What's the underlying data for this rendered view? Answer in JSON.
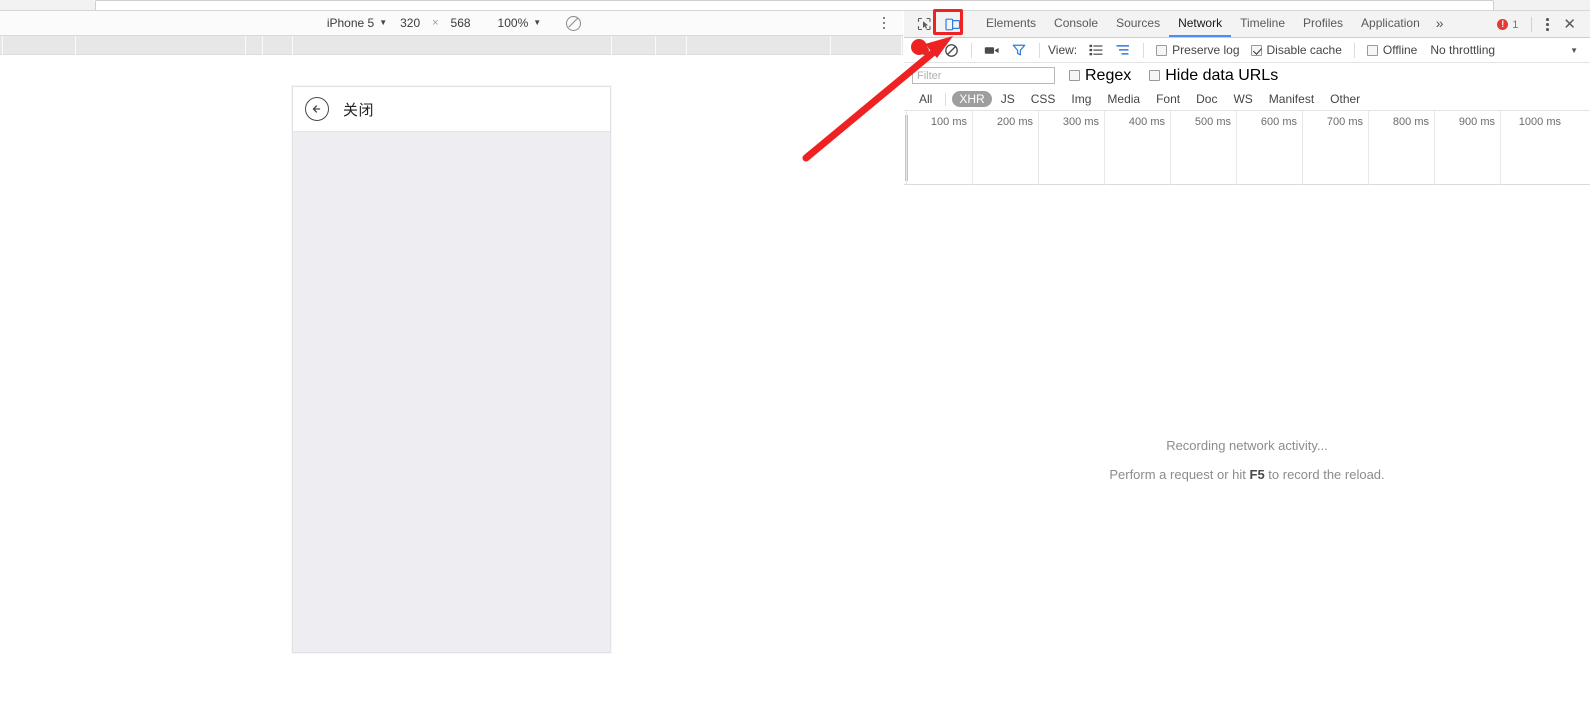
{
  "browser": {
    "omnibar_placeholder": ""
  },
  "device_toolbar": {
    "device_name": "iPhone 5",
    "width": "320",
    "height": "568",
    "dim_separator": "×",
    "zoom": "100%",
    "throttle_icon": "no-throttling-icon",
    "menu_icon": "kebab-menu-icon"
  },
  "mobile_page": {
    "back_icon": "back-arrow-icon",
    "title": "关闭"
  },
  "devtools": {
    "inspect_icon": "inspect-element-icon",
    "device_toggle_icon": "toggle-device-toolbar-icon",
    "tabs": [
      {
        "label": "Elements",
        "active": false
      },
      {
        "label": "Console",
        "active": false
      },
      {
        "label": "Sources",
        "active": false
      },
      {
        "label": "Network",
        "active": true
      },
      {
        "label": "Timeline",
        "active": false
      },
      {
        "label": "Profiles",
        "active": false
      },
      {
        "label": "Application",
        "active": false
      }
    ],
    "more_tabs_label": "»",
    "error_count": "1",
    "error_color": "#e53935",
    "kebab_icon": "devtools-menu-icon",
    "close_icon": "close-devtools-icon",
    "accent_color": "#4a8df8",
    "network_toolbar": {
      "record_icon": "record-button-icon",
      "clear_icon": "clear-network-log-icon",
      "capture_screenshots_icon": "camera-icon",
      "filter_icon": "filter-funnel-icon",
      "view_label": "View:",
      "view_list_icon": "list-view-icon",
      "view_waterfall_icon": "waterfall-view-icon",
      "preserve_log_label": "Preserve log",
      "preserve_log_checked": false,
      "disable_cache_label": "Disable cache",
      "disable_cache_checked": true,
      "offline_label": "Offline",
      "offline_checked": false,
      "throttling_value": "No throttling",
      "throttling_caret": "▼"
    },
    "filter_row": {
      "filter_placeholder": "Filter",
      "filter_value": "",
      "regex_label": "Regex",
      "regex_checked": false,
      "hide_data_urls_label": "Hide data URLs",
      "hide_data_urls_checked": false
    },
    "type_filters": [
      {
        "label": "All",
        "selected": false
      },
      {
        "label": "XHR",
        "selected": true
      },
      {
        "label": "JS",
        "selected": false
      },
      {
        "label": "CSS",
        "selected": false
      },
      {
        "label": "Img",
        "selected": false
      },
      {
        "label": "Media",
        "selected": false
      },
      {
        "label": "Font",
        "selected": false
      },
      {
        "label": "Doc",
        "selected": false
      },
      {
        "label": "WS",
        "selected": false
      },
      {
        "label": "Manifest",
        "selected": false
      },
      {
        "label": "Other",
        "selected": false
      }
    ],
    "timeline_ticks": [
      "100 ms",
      "200 ms",
      "300 ms",
      "400 ms",
      "500 ms",
      "600 ms",
      "700 ms",
      "800 ms",
      "900 ms",
      "1000 ms"
    ],
    "empty_state": {
      "line1": "Recording network activity...",
      "line2_prefix": "Perform a request or hit ",
      "line2_key": "F5",
      "line2_suffix": " to record the reload."
    }
  },
  "annotation": {
    "arrow_color": "#ee2222",
    "highlight_color": "#ee2222",
    "target": "toggle-device-toolbar-icon"
  }
}
